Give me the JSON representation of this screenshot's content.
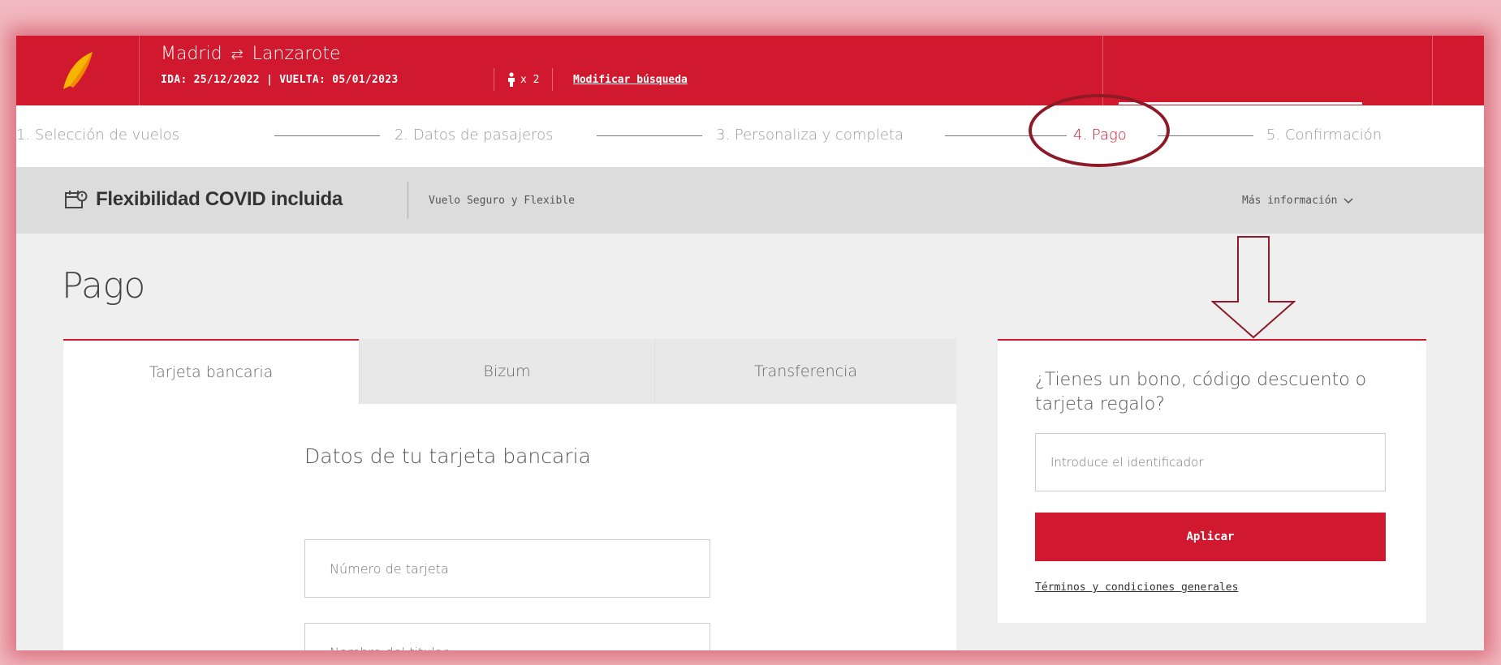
{
  "header": {
    "route_from": "Madrid",
    "route_swap_icon": "⇄",
    "route_to": "Lanzarote",
    "dates": "IDA: 25/12/2022 | VUELTA: 05/01/2023",
    "passengers": "x 2",
    "modify_search": "Modificar búsqueda",
    "brand_color": "#d0192e"
  },
  "steps": [
    {
      "label": "1. Selección de vuelos",
      "active": false
    },
    {
      "label": "2. Datos de pasajeros",
      "active": false
    },
    {
      "label": "3. Personaliza y completa",
      "active": false
    },
    {
      "label": "4. Pago",
      "active": true
    },
    {
      "label": "5. Confirmación",
      "active": false
    }
  ],
  "covid_bar": {
    "title": "Flexibilidad COVID incluida",
    "subtitle": "Vuelo Seguro y Flexible",
    "more_info": "Más información"
  },
  "page": {
    "title": "Pago"
  },
  "payment": {
    "tabs": [
      "Tarjeta bancaria",
      "Bizum",
      "Transferencia"
    ],
    "active_tab": "Tarjeta bancaria",
    "card_heading": "Datos de tu tarjeta bancaria",
    "card_number_placeholder": "Número de tarjeta",
    "card_holder_placeholder": "Nombre del titular"
  },
  "voucher": {
    "title": "¿Tienes un bono, código descuento o tarjeta regalo?",
    "input_placeholder": "Introduce el identificador",
    "apply_label": "Aplicar",
    "terms_label": "Términos y condiciones generales"
  }
}
